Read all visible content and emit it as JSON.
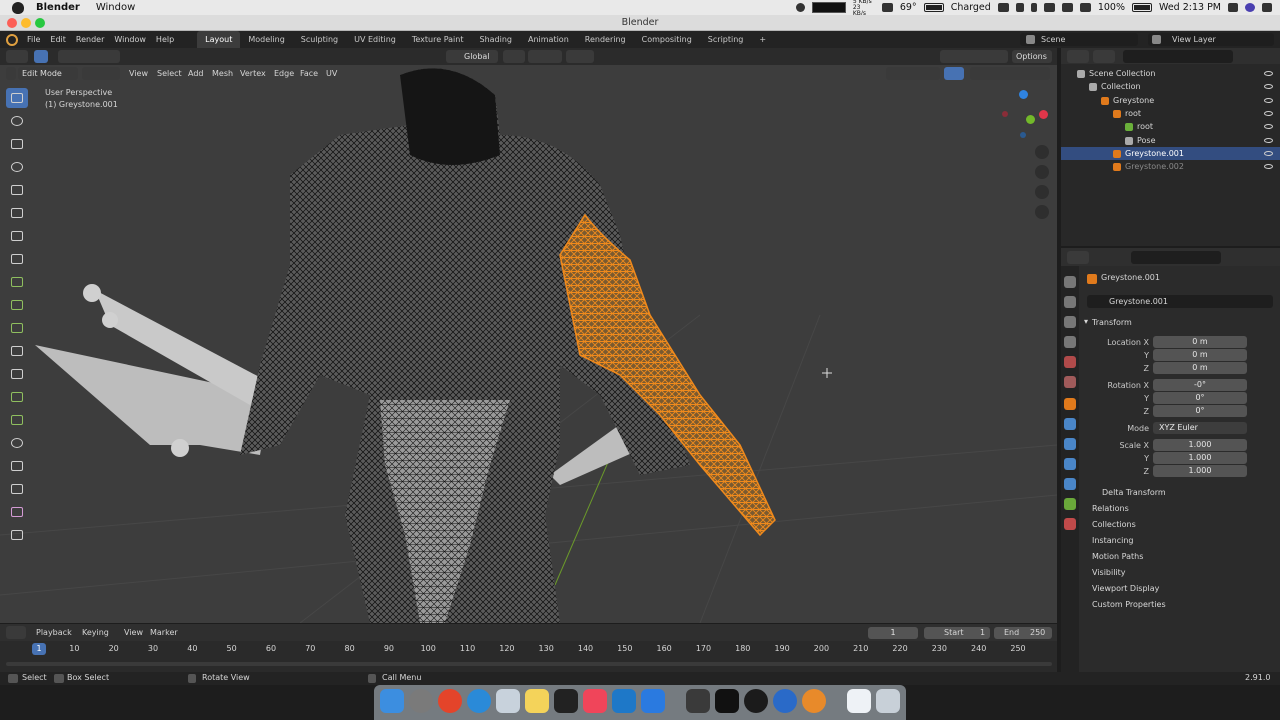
{
  "menubar": {
    "app": "Blender",
    "items": [
      "Window"
    ],
    "temp": "69°",
    "net": "5 KB/s 23 KB/s",
    "battery_status": "Charged",
    "battery_pct": "100%",
    "clock": "Wed 2:13 PM"
  },
  "window": {
    "title": "Blender"
  },
  "topbar": {
    "menus": [
      "File",
      "Edit",
      "Render",
      "Window",
      "Help"
    ],
    "workspaces": [
      "Layout",
      "Modeling",
      "Sculpting",
      "UV Editing",
      "Texture Paint",
      "Shading",
      "Animation",
      "Rendering",
      "Compositing",
      "Scripting"
    ],
    "active_workspace": "Layout",
    "scene": "Scene",
    "view_layer": "View Layer"
  },
  "viewport_header": {
    "orientation": "Global",
    "options": "Options",
    "mode": "Edit Mode",
    "menus": [
      "View",
      "Select",
      "Add",
      "Mesh",
      "Vertex",
      "Edge",
      "Face",
      "UV"
    ]
  },
  "viewport": {
    "perspective": "User Perspective",
    "object_info": "(1) Greystone.001",
    "gizmo_axes": [
      "X",
      "Y",
      "Z"
    ]
  },
  "outliner": {
    "rows": [
      {
        "label": "Scene Collection",
        "indent": 0
      },
      {
        "label": "Collection",
        "indent": 1
      },
      {
        "label": "Greystone",
        "indent": 2
      },
      {
        "label": "root",
        "indent": 3
      },
      {
        "label": "root",
        "indent": 4
      },
      {
        "label": "Pose",
        "indent": 4
      },
      {
        "label": "Greystone.001",
        "indent": 3,
        "selected": true
      },
      {
        "label": "Greystone.002",
        "indent": 3
      }
    ]
  },
  "properties": {
    "object_name": "Greystone.001",
    "object_field": "Greystone.001",
    "transform_title": "Transform",
    "location_label": "Location X",
    "rotation_label": "Rotation X",
    "scale_label": "Scale X",
    "y_label": "Y",
    "z_label": "Z",
    "location": [
      "0 m",
      "0 m",
      "0 m"
    ],
    "rotation": [
      "-0°",
      "0°",
      "0°"
    ],
    "mode_label": "Mode",
    "mode_value": "XYZ Euler",
    "scale": [
      "1.000",
      "1.000",
      "1.000"
    ],
    "delta": "Delta Transform",
    "panels": [
      "Relations",
      "Collections",
      "Instancing",
      "Motion Paths",
      "Visibility",
      "Viewport Display",
      "Custom Properties"
    ]
  },
  "timeline": {
    "menus": [
      "Playback",
      "Keying",
      "View",
      "Marker"
    ],
    "current_frame": "1",
    "start_label": "Start",
    "start": "1",
    "end_label": "End",
    "end": "250",
    "ticks": [
      "10",
      "20",
      "30",
      "40",
      "50",
      "60",
      "70",
      "80",
      "90",
      "100",
      "110",
      "120",
      "130",
      "140",
      "150",
      "160",
      "170",
      "180",
      "190",
      "200",
      "210",
      "220",
      "230",
      "240",
      "250"
    ],
    "playhead": "1"
  },
  "statusbar": {
    "select": "Select",
    "box_select": "Box Select",
    "rotate_view": "Rotate View",
    "call_menu": "Call Menu",
    "version": "2.91.0"
  },
  "colors": {
    "accent": "#4772b3",
    "selection_orange": "#f08a1c",
    "viewport_bg": "#3d3d3d"
  }
}
